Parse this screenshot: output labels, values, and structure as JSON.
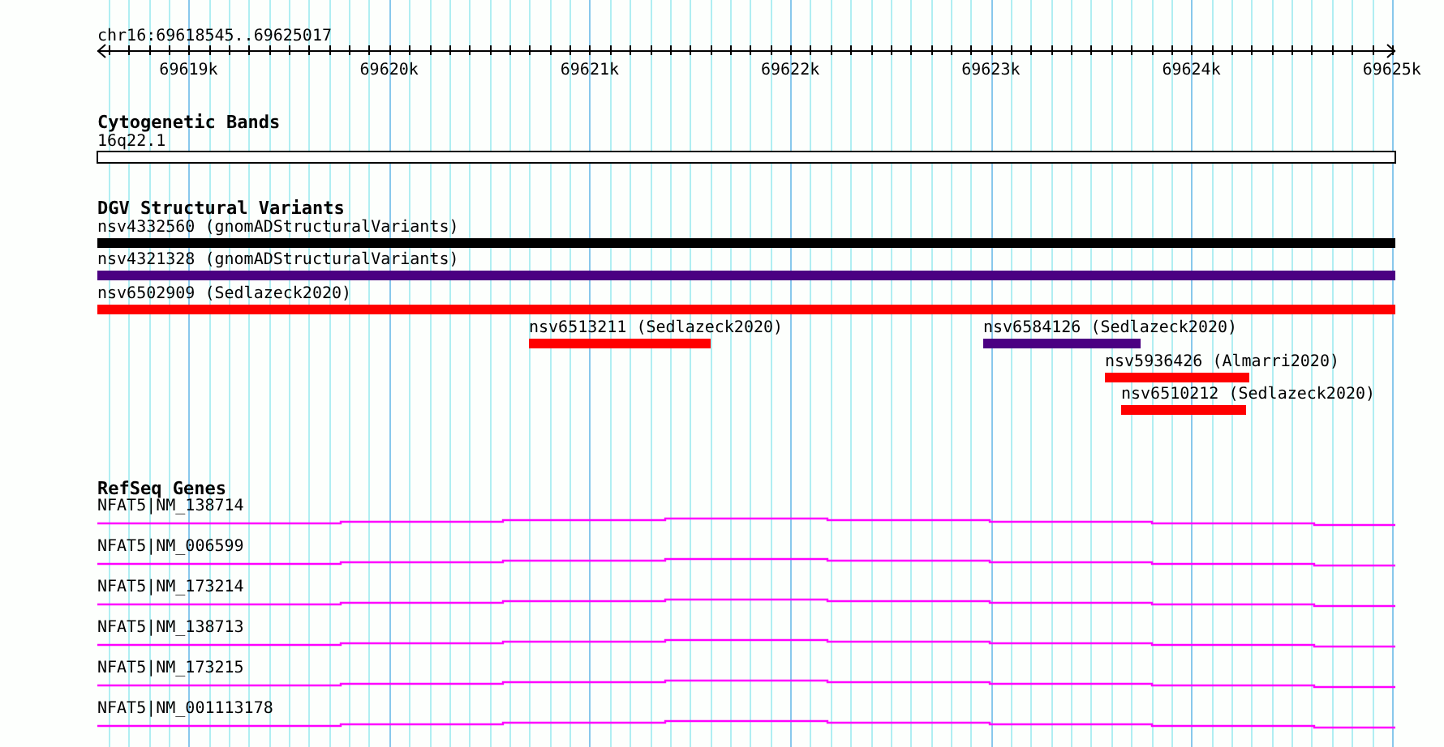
{
  "ruler": {
    "title": "chr16:69618545..69625017",
    "ticks": [
      "69619k",
      "69620k",
      "69621k",
      "69622k",
      "69623k",
      "69624k",
      "69625k"
    ]
  },
  "tracks": [
    {
      "kind": "bands",
      "title": "Cytogenetic Bands",
      "features": [
        {
          "label": "16q22.1"
        }
      ]
    },
    {
      "kind": "variants",
      "title": "DGV Structural Variants",
      "features": [
        {
          "label": "nsv4332560 (gnomADStructuralVariants)",
          "color": "#000000"
        },
        {
          "label": "nsv4321328 (gnomADStructuralVariants)",
          "color": "#4b0082"
        },
        {
          "label": "nsv6502909 (Sedlazeck2020)",
          "color": "#ff0000"
        },
        {
          "label": "nsv6513211 (Sedlazeck2020)",
          "color": "#ff0000"
        },
        {
          "label": "nsv6584126 (Sedlazeck2020)",
          "color": "#4b0082"
        },
        {
          "label": "nsv5936426 (Almarri2020)",
          "color": "#ff0000"
        },
        {
          "label": "nsv6510212 (Sedlazeck2020)",
          "color": "#ff0000"
        }
      ]
    },
    {
      "kind": "genes",
      "title": "RefSeq Genes",
      "features": [
        {
          "label": "NFAT5|NM_138714"
        },
        {
          "label": "NFAT5|NM_006599"
        },
        {
          "label": "NFAT5|NM_173214"
        },
        {
          "label": "NFAT5|NM_138713"
        },
        {
          "label": "NFAT5|NM_173215"
        },
        {
          "label": "NFAT5|NM_001113178"
        }
      ]
    }
  ]
}
